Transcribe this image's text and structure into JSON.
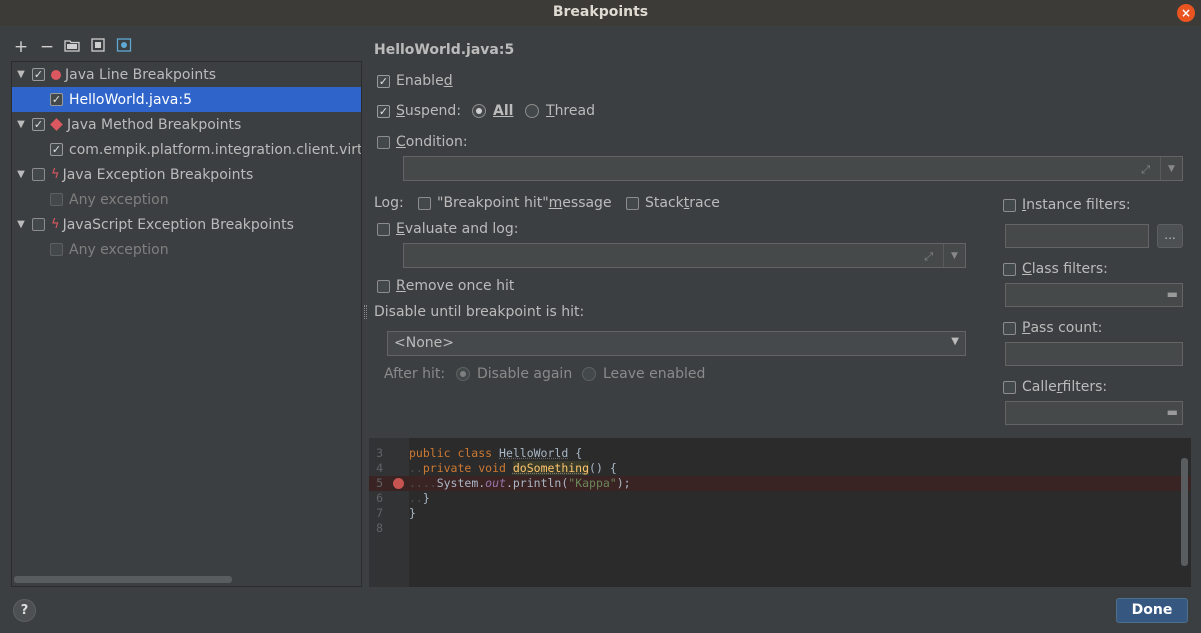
{
  "window": {
    "title": "Breakpoints",
    "close_glyph": "×"
  },
  "toolbar": {
    "add_glyph": "+",
    "remove_glyph": "−",
    "icons": [
      "folder-icon",
      "group-icon",
      "settings-icon"
    ]
  },
  "tree": {
    "items": [
      {
        "label": "Java Line Breakpoints",
        "checked": true,
        "expandable": true,
        "icon": "breakpoint-dot-icon"
      },
      {
        "label": "HelloWorld.java:5",
        "checked": true,
        "selected": true
      },
      {
        "label": "Java Method Breakpoints",
        "checked": true,
        "expandable": true,
        "icon": "breakpoint-diamond-icon"
      },
      {
        "label": "com.empik.platform.integration.client.virtu",
        "checked": true
      },
      {
        "label": "Java Exception Breakpoints",
        "checked": false,
        "expandable": true,
        "icon": "exception-bolt-icon"
      },
      {
        "label": "Any exception",
        "checked": false,
        "disabled": true
      },
      {
        "label": "JavaScript Exception Breakpoints",
        "checked": false,
        "expandable": true,
        "icon": "exception-bolt-icon"
      },
      {
        "label": "Any exception",
        "checked": false,
        "disabled": true
      }
    ]
  },
  "details": {
    "header": "HelloWorld.java:5",
    "enabled": {
      "label_pre": "Enable",
      "label_u": "d",
      "label_post": "",
      "checked": true
    },
    "suspend": {
      "label_pre": "",
      "label_u": "S",
      "label_post": "uspend:",
      "checked": true
    },
    "suspend_all": {
      "label": "All",
      "selected": true
    },
    "suspend_thread": {
      "label_u": "T",
      "label_post": "hread",
      "selected": false
    },
    "condition": {
      "label_u": "C",
      "label_post": "ondition:",
      "checked": false,
      "value": ""
    },
    "log": {
      "label": "Log:",
      "message": {
        "label_pre": "\"Breakpoint hit\" ",
        "label_u": "m",
        "label_post": "essage",
        "checked": false
      },
      "stack_trace": {
        "label_pre": "Stack ",
        "label_u": "t",
        "label_post": "race",
        "checked": false
      }
    },
    "evaluate": {
      "label_u": "E",
      "label_post": "valuate and log:",
      "checked": false,
      "value": ""
    },
    "remove_once_hit": {
      "label_u": "R",
      "label_post": "emove once hit",
      "checked": false
    },
    "disable_until": {
      "label": "Disable until breakpoint is hit:",
      "selected": "<None>"
    },
    "after_hit": {
      "label": "After hit:",
      "disable_again": {
        "label": "Disable again",
        "selected": true
      },
      "leave_enabled": {
        "label": "Leave enabled",
        "selected": false
      }
    },
    "filters": {
      "instance": {
        "label_u": "I",
        "label_post": "nstance filters:",
        "checked": false,
        "more_button": "..."
      },
      "class": {
        "label_u": "C",
        "label_post": "lass filters:",
        "checked": false
      },
      "pass_count": {
        "label_u": "P",
        "label_post": "ass count:",
        "checked": false
      },
      "caller": {
        "label_pre": "Calle",
        "label_u": "r",
        "label_post": " filters:",
        "checked": false
      }
    }
  },
  "editor": {
    "lines": [
      {
        "num": "3",
        "parts": [
          [
            "kw",
            "public class "
          ],
          [
            "cls",
            "HelloWorld"
          ],
          [
            "txt",
            " {"
          ]
        ]
      },
      {
        "num": "4",
        "parts": [
          [
            "dots",
            ".."
          ],
          [
            "kw",
            "private void "
          ],
          [
            "fn",
            "doSomething"
          ],
          [
            "txt",
            "() {"
          ]
        ]
      },
      {
        "num": "5",
        "breakpoint": true,
        "parts": [
          [
            "dots",
            "...."
          ],
          [
            "txt",
            "System."
          ],
          [
            "ital",
            "out"
          ],
          [
            "txt",
            ".println("
          ],
          [
            "str",
            "\"Kappa\""
          ],
          [
            "txt",
            ");"
          ]
        ]
      },
      {
        "num": "6",
        "parts": [
          [
            "dots",
            ".."
          ],
          [
            "txt",
            "}"
          ]
        ]
      },
      {
        "num": "7",
        "parts": [
          [
            "txt",
            "}"
          ]
        ]
      },
      {
        "num": "8",
        "parts": []
      }
    ]
  },
  "footer": {
    "help": "?",
    "done": "Done"
  },
  "colors": {
    "accent": "#2f65ca",
    "breakpoint": "#db5860",
    "done_button": "#365880"
  }
}
